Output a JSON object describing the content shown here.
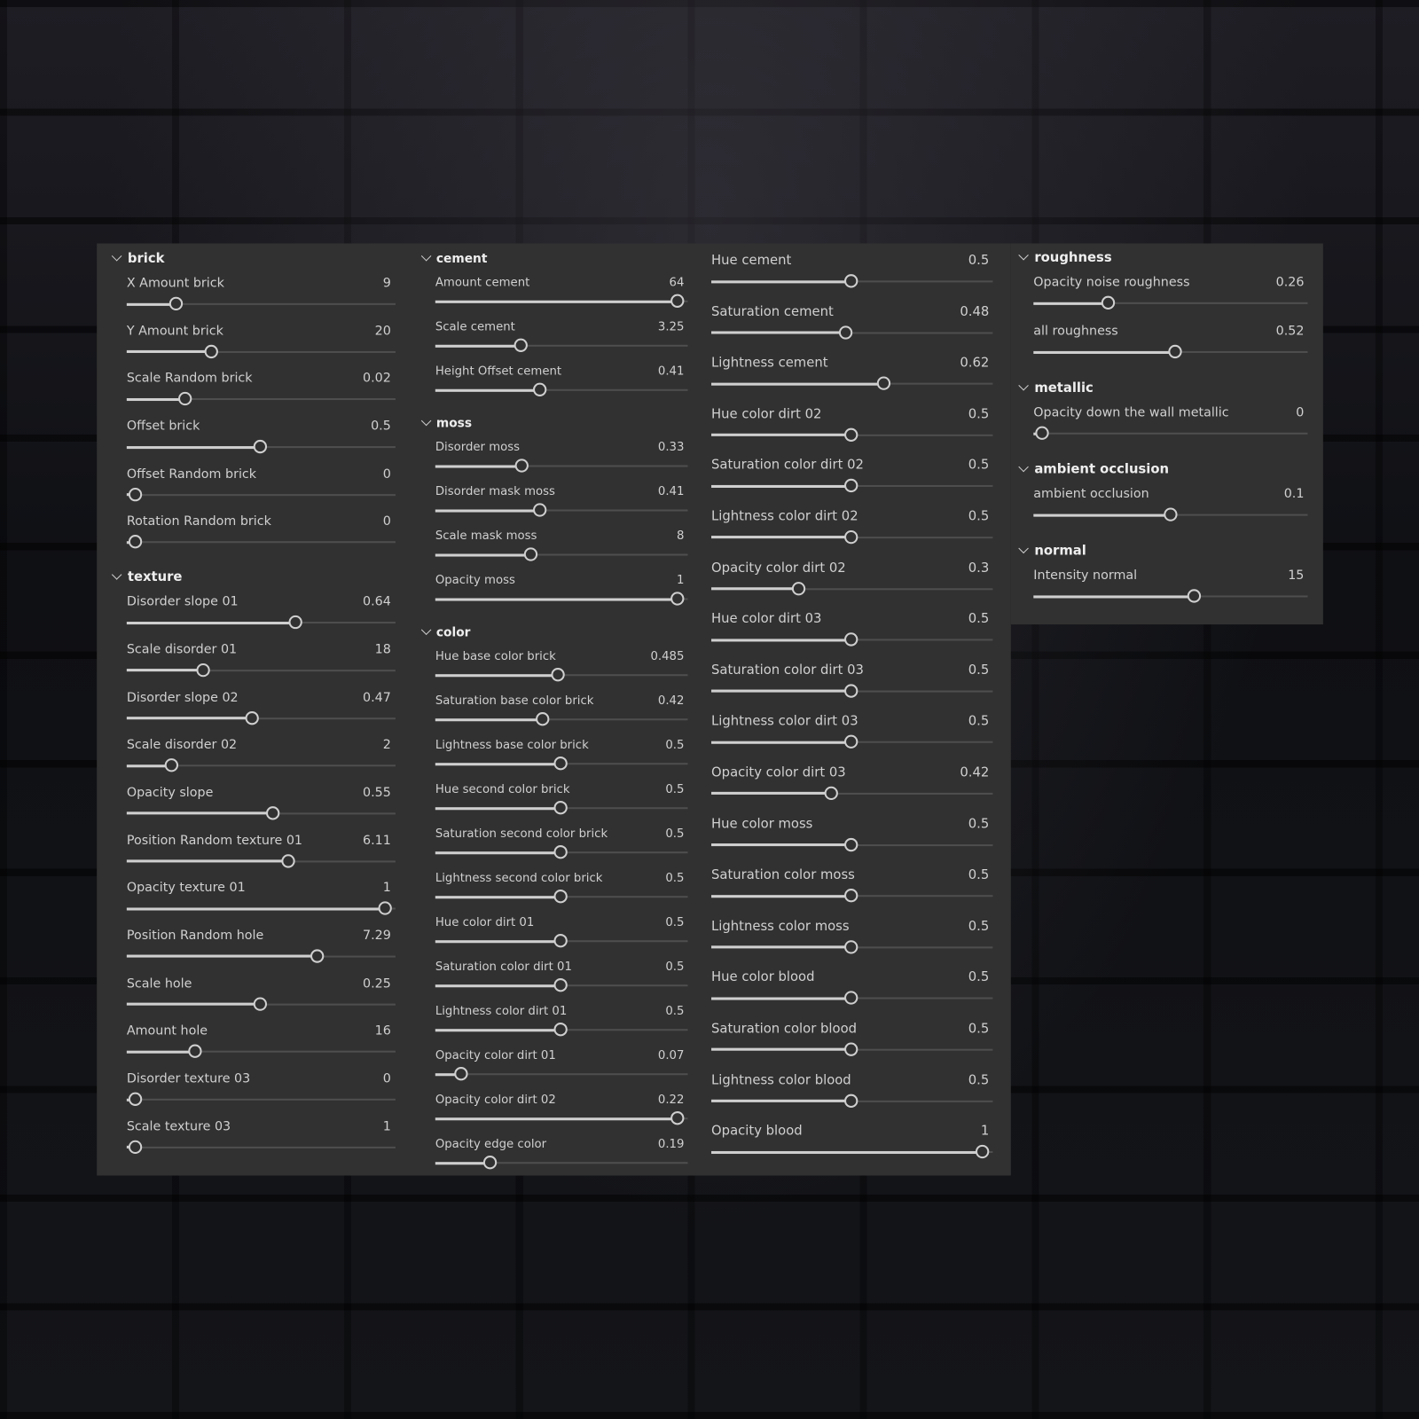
{
  "columns": [
    {
      "sections": [
        {
          "title": "brick",
          "params": [
            {
              "label": "X Amount brick",
              "value": "9",
              "fraction": 0.163
            },
            {
              "label": "Y Amount brick",
              "value": "20",
              "fraction": 0.304
            },
            {
              "label": "Scale Random brick",
              "value": "0.02",
              "fraction": 0.199
            },
            {
              "label": "Offset brick",
              "value": "0.5",
              "fraction": 0.5
            },
            {
              "label": "Offset Random brick",
              "value": "0",
              "fraction": 0
            },
            {
              "label": "Rotation Random brick",
              "value": "0",
              "fraction": 0
            }
          ]
        },
        {
          "title": "texture",
          "params": [
            {
              "label": "Disorder slope 01",
              "value": "0.64",
              "fraction": 0.641
            },
            {
              "label": "Scale disorder 01",
              "value": "18",
              "fraction": 0.272
            },
            {
              "label": "Disorder slope 02",
              "value": "0.47",
              "fraction": 0.467
            },
            {
              "label": "Scale disorder 02",
              "value": "2",
              "fraction": 0.145
            },
            {
              "label": "Opacity slope",
              "value": "0.55",
              "fraction": 0.551
            },
            {
              "label": "Position Random texture 01",
              "value": "6.11",
              "fraction": 0.612
            },
            {
              "label": "Opacity texture 01",
              "value": "1",
              "fraction": 1
            },
            {
              "label": "Position Random hole",
              "value": "7.29",
              "fraction": 0.728
            },
            {
              "label": "Scale hole",
              "value": "0.25",
              "fraction": 0.5
            },
            {
              "label": "Amount hole",
              "value": "16",
              "fraction": 0.239
            },
            {
              "label": "Disorder texture 03",
              "value": "0",
              "fraction": 0
            },
            {
              "label": "Scale texture 03",
              "value": "1",
              "fraction": 0
            }
          ]
        }
      ]
    },
    {
      "sections": [
        {
          "title": "cement",
          "params": [
            {
              "label": "Amount cement",
              "value": "64",
              "fraction": 1
            },
            {
              "label": "Scale cement",
              "value": "3.25",
              "fraction": 0.331
            },
            {
              "label": "Height Offset cement",
              "value": "0.41",
              "fraction": 0.41
            }
          ]
        },
        {
          "title": "moss",
          "params": [
            {
              "label": "Disorder moss",
              "value": "0.33",
              "fraction": 0.335
            },
            {
              "label": "Disorder mask moss",
              "value": "0.41",
              "fraction": 0.41
            },
            {
              "label": "Scale mask moss",
              "value": "8",
              "fraction": 0.373
            },
            {
              "label": "Opacity moss",
              "value": "1",
              "fraction": 1
            }
          ]
        },
        {
          "title": "color",
          "params": [
            {
              "label": "Hue base color brick",
              "value": "0.485",
              "fraction": 0.488
            },
            {
              "label": "Saturation base color brick",
              "value": "0.42",
              "fraction": 0.423
            },
            {
              "label": "Lightness base color brick",
              "value": "0.5",
              "fraction": 0.5
            },
            {
              "label": "Hue second color brick",
              "value": "0.5",
              "fraction": 0.5
            },
            {
              "label": "Saturation second color brick",
              "value": "0.5",
              "fraction": 0.5
            },
            {
              "label": "Lightness second color brick",
              "value": "0.5",
              "fraction": 0.5
            },
            {
              "label": "Hue color dirt 01",
              "value": "0.5",
              "fraction": 0.5
            },
            {
              "label": "Saturation color dirt 01",
              "value": "0.5",
              "fraction": 0.5
            },
            {
              "label": "Lightness color dirt 01",
              "value": "0.5",
              "fraction": 0.5
            },
            {
              "label": "Opacity color dirt 01",
              "value": "0.07",
              "fraction": 0.073
            },
            {
              "label": "Opacity color dirt 02",
              "value": "0.22",
              "fraction": 1
            },
            {
              "label": "Opacity edge color",
              "value": "0.19",
              "fraction": 0.196
            }
          ]
        }
      ]
    },
    {
      "sections": [
        {
          "title": null,
          "params": [
            {
              "label": "Hue cement",
              "value": "0.5",
              "fraction": 0.5
            },
            {
              "label": "Saturation cement",
              "value": "0.48",
              "fraction": 0.479
            },
            {
              "label": "Lightness cement",
              "value": "0.62",
              "fraction": 0.624
            },
            {
              "label": "Hue color dirt 02",
              "value": "0.5",
              "fraction": 0.5
            },
            {
              "label": "Saturation color dirt 02",
              "value": "0.5",
              "fraction": 0.5
            },
            {
              "label": "Lightness color dirt 02",
              "value": "0.5",
              "fraction": 0.5
            },
            {
              "label": "Opacity color dirt 02",
              "value": "0.3",
              "fraction": 0.3
            },
            {
              "label": "Hue color dirt 03",
              "value": "0.5",
              "fraction": 0.5
            },
            {
              "label": "Saturation color dirt 03",
              "value": "0.5",
              "fraction": 0.5
            },
            {
              "label": "Lightness color dirt 03",
              "value": "0.5",
              "fraction": 0.5
            },
            {
              "label": "Opacity color dirt 03",
              "value": "0.42",
              "fraction": 0.424
            },
            {
              "label": "Hue color moss",
              "value": "0.5",
              "fraction": 0.5
            },
            {
              "label": "Saturation color moss",
              "value": "0.5",
              "fraction": 0.5
            },
            {
              "label": "Lightness color moss",
              "value": "0.5",
              "fraction": 0.5
            },
            {
              "label": "Hue color blood",
              "value": "0.5",
              "fraction": 0.5
            },
            {
              "label": "Saturation color blood",
              "value": "0.5",
              "fraction": 0.5
            },
            {
              "label": "Lightness color blood",
              "value": "0.5",
              "fraction": 0.5
            },
            {
              "label": "Opacity blood",
              "value": "1",
              "fraction": 1
            }
          ]
        }
      ]
    },
    {
      "sections": [
        {
          "title": "roughness",
          "params": [
            {
              "label": "Opacity noise roughness",
              "value": "0.26",
              "fraction": 0.26
            },
            {
              "label": "all roughness",
              "value": "0.52",
              "fraction": 0.523
            }
          ]
        },
        {
          "title": "metallic",
          "params": [
            {
              "label": "Opacity down the wall metallic",
              "value": "0",
              "fraction": 0
            }
          ]
        },
        {
          "title": "ambient occlusion",
          "params": [
            {
              "label": "ambient occlusion",
              "value": "0.1",
              "fraction": 0.502
            }
          ]
        },
        {
          "title": "normal",
          "params": [
            {
              "label": "Intensity normal",
              "value": "15",
              "fraction": 0.597
            }
          ]
        }
      ]
    }
  ]
}
